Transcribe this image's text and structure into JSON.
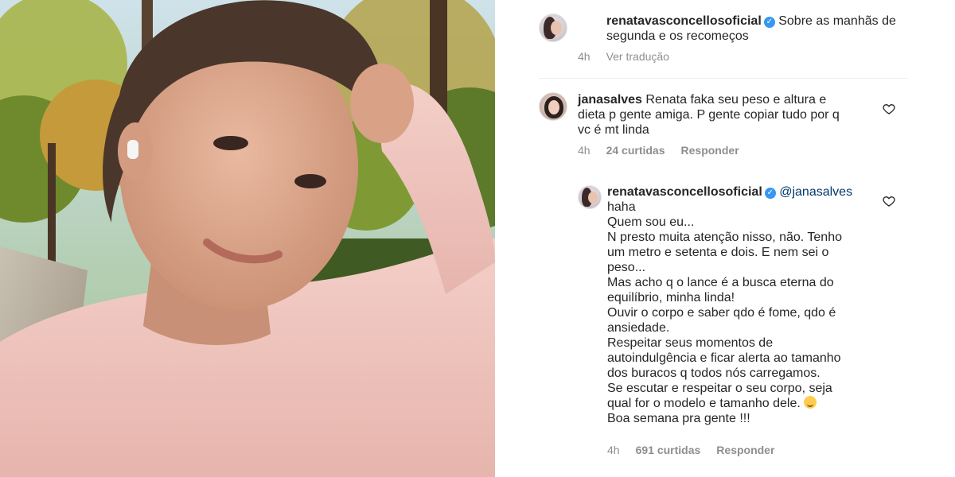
{
  "post": {
    "caption": {
      "username": "renatavasconcellosoficial",
      "text_line1": "Sobre as manhãs de",
      "text_line2": "segunda e os recomeços",
      "time": "4h",
      "translate_label": "Ver tradução"
    }
  },
  "comments": [
    {
      "username": "janasalves",
      "lines": [
        "Renata faka seu peso e altura e",
        "dieta p gente amiga. P gente copiar tudo por q",
        "vc é mt linda"
      ],
      "time": "4h",
      "likes": "24 curtidas",
      "reply_label": "Responder"
    }
  ],
  "reply": {
    "username": "renatavasconcellosoficial",
    "mention": "@janasalves",
    "lines": [
      "haha",
      "Quem sou eu...",
      "N presto muita atenção nisso, não. Tenho",
      "um metro e setenta e dois. E nem sei o",
      "peso...",
      "Mas acho q o lance é a busca eterna do",
      "equilíbrio, minha linda!",
      "Ouvir o corpo e saber qdo é fome, qdo é",
      "ansiedade.",
      "Respeitar seus momentos de",
      "autoindulgência e ficar alerta ao tamanho",
      "dos buracos q todos nós carregamos.",
      "Se escutar e respeitar o seu corpo, seja",
      "qual for o modelo e tamanho dele.",
      "Boa semana pra gente !!!"
    ],
    "emoji": "relieved-smile",
    "time": "4h",
    "likes": "691 curtidas",
    "reply_label": "Responder"
  },
  "icons": {
    "verified": "verified-badge-icon",
    "like": "heart-outline-icon"
  },
  "colors": {
    "username": "#262626",
    "meta": "#8e8e8e",
    "mention": "#00376b",
    "verified": "#3897f0"
  }
}
